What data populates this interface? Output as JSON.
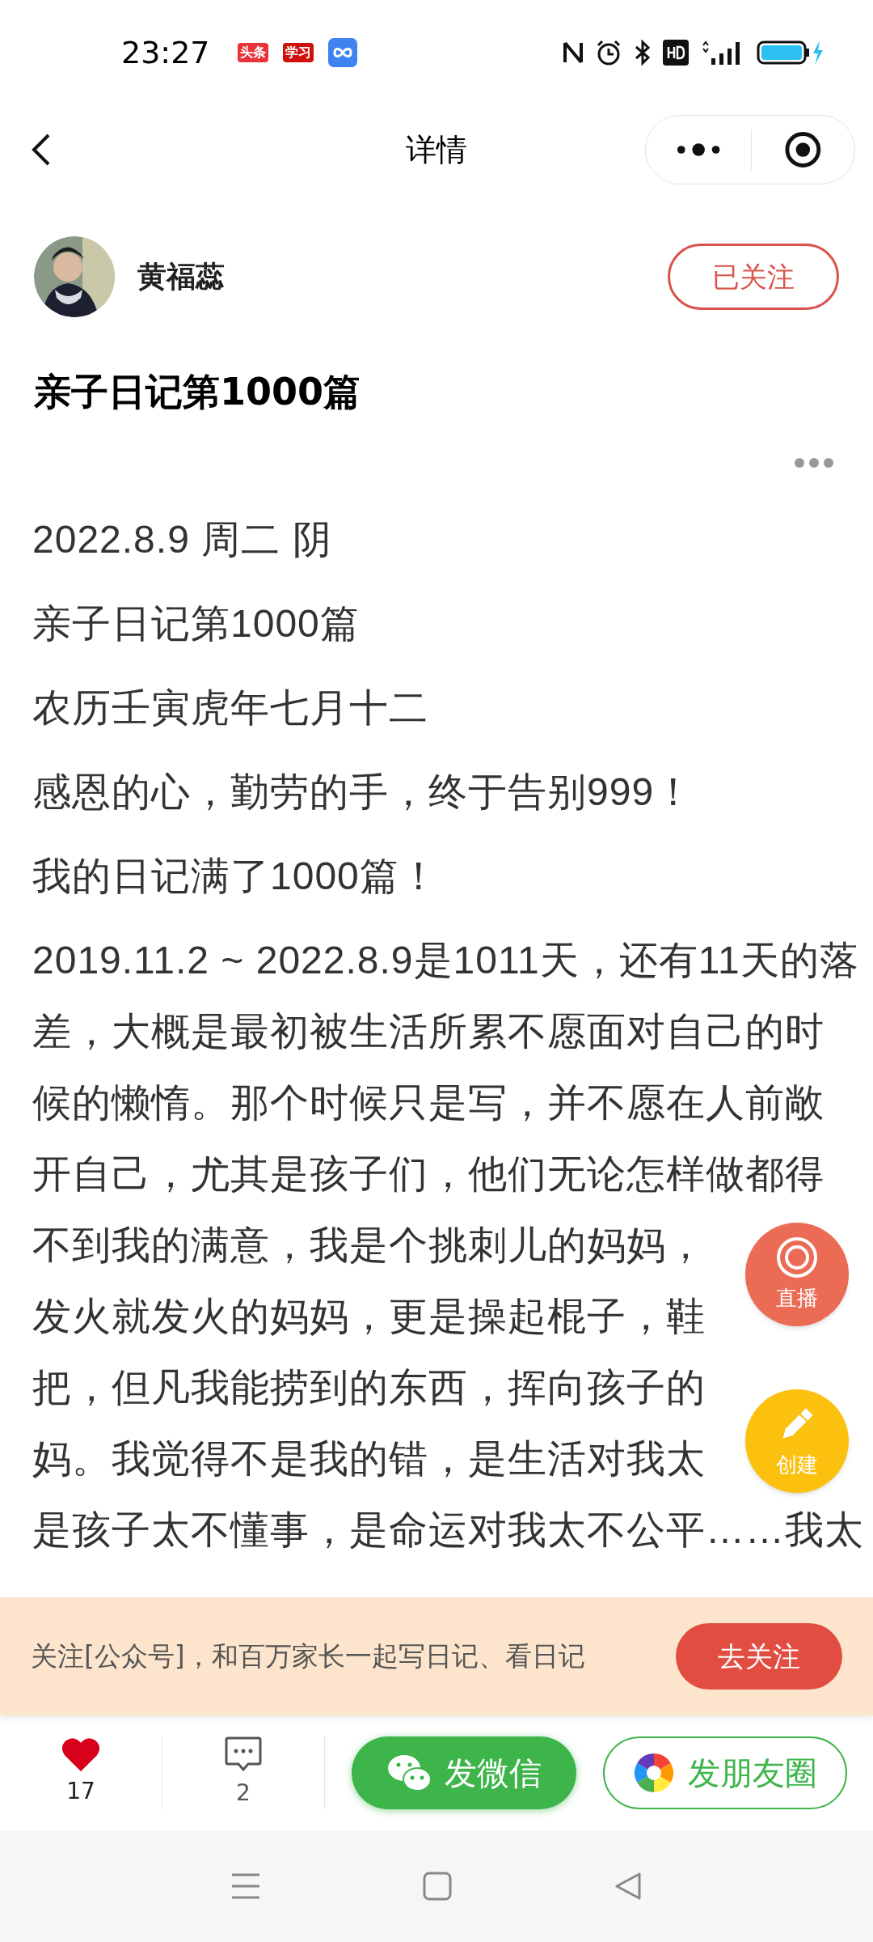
{
  "status_bar": {
    "time": "23:27",
    "app_badges": [
      {
        "label": "头条",
        "color": "#e8333a"
      },
      {
        "label": "学习",
        "color": "#d0100c"
      }
    ]
  },
  "nav": {
    "title": "详情"
  },
  "author": {
    "name": "黄福蕊",
    "follow_button": {
      "label": "已关注",
      "followed": true
    }
  },
  "article": {
    "title": "亲子日记第1000篇",
    "paragraphs": [
      {
        "lines": [
          "2022.8.9 周二 阴"
        ]
      },
      {
        "lines": [
          "亲子日记第1000篇"
        ]
      },
      {
        "lines": [
          "农历壬寅虎年七月十二"
        ]
      },
      {
        "lines": [
          "感恩的心，勤劳的手，终于告别999！"
        ]
      },
      {
        "lines": [
          "我的日记满了1000篇！"
        ]
      },
      {
        "lines": [
          "2019.11.2 ~ 2022.8.9是1011天，还有11天的落",
          "差，大概是最初被生活所累不愿面对自己的时",
          "候的懒惰。那个时候只是写，并不愿在人前敞",
          "开自己，尤其是孩子们，他们无论怎样做都得",
          "不到我的满意，我是个挑刺儿的妈妈，",
          "发火就发火的妈妈，更是操起棍子，鞋",
          "把，但凡我能捞到的东西，挥向孩子的",
          "妈。我觉得不是我的错，是生活对我太",
          "是孩子太不懂事，是命运对我太不公平……我太"
        ]
      }
    ]
  },
  "floating_actions": [
    {
      "label": "直播",
      "kind": "live",
      "color": "#ec6b55"
    },
    {
      "label": "创建",
      "kind": "create",
      "color": "#fcc00f"
    }
  ],
  "banner": {
    "text": "关注[公众号]，和百万家长一起写日记、看日记",
    "button": "去关注"
  },
  "actions": {
    "like": {
      "count": "17",
      "liked": true
    },
    "comment": {
      "count": "2"
    },
    "share_buttons": [
      {
        "label": "发微信",
        "kind": "wechat"
      },
      {
        "label": "发朋友圈",
        "kind": "moments"
      }
    ]
  }
}
